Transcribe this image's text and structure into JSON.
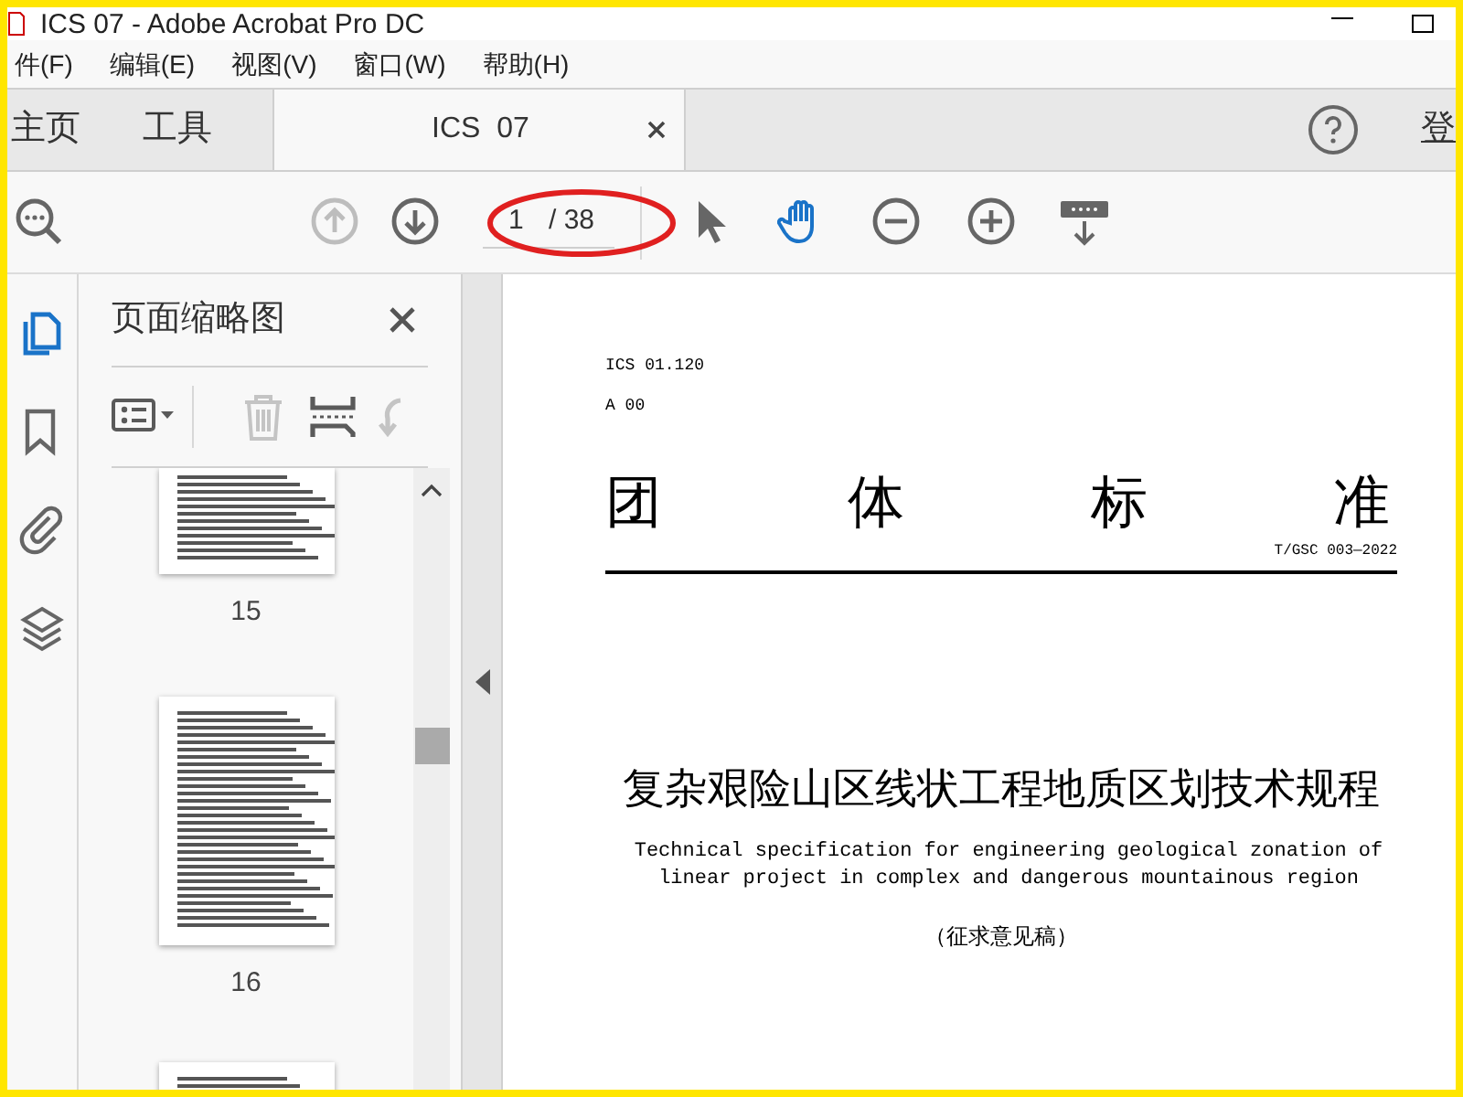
{
  "window": {
    "title": "ICS 07 - Adobe Acrobat Pro DC"
  },
  "menu": [
    "件(F)",
    "编辑(E)",
    "视图(V)",
    "窗口(W)",
    "帮助(H)"
  ],
  "tabs": [
    {
      "label": "主页",
      "kind": "nav",
      "selected": false
    },
    {
      "label": "工具",
      "kind": "nav",
      "selected": false
    },
    {
      "label": "ICS  07",
      "kind": "document",
      "selected": true
    }
  ],
  "account": {
    "label": "登"
  },
  "toolbar": {
    "tools": [
      {
        "kind": "find",
        "disabled": false,
        "selected": false
      },
      {
        "kind": "prev-page",
        "disabled": true,
        "selected": false
      },
      {
        "kind": "next-page",
        "disabled": false,
        "selected": false
      },
      {
        "kind": "page-field",
        "value": "1",
        "total": "/ 38"
      },
      {
        "kind": "select",
        "disabled": false,
        "selected": false
      },
      {
        "kind": "hand",
        "disabled": false,
        "selected": true
      },
      {
        "kind": "zoom-out",
        "disabled": false,
        "selected": false
      },
      {
        "kind": "zoom-in",
        "disabled": false,
        "selected": false
      },
      {
        "kind": "keyboard-download",
        "disabled": false,
        "selected": false
      }
    ]
  },
  "rail": [
    {
      "kind": "pages",
      "selected": true
    },
    {
      "kind": "bookmark",
      "selected": false
    },
    {
      "kind": "attachment",
      "selected": false
    },
    {
      "kind": "layers",
      "selected": false
    }
  ],
  "thumbnail_panel": {
    "title": "页面缩略图",
    "tools": [
      {
        "kind": "options",
        "disabled": false
      },
      {
        "kind": "delete",
        "disabled": true
      },
      {
        "kind": "insert",
        "disabled": false
      },
      {
        "kind": "rotate",
        "disabled": true
      }
    ],
    "thumbnails": [
      {
        "label": "15",
        "kind": "cut-top"
      },
      {
        "label": "16",
        "kind": "full"
      },
      {
        "kind": "cut-bottom"
      }
    ]
  },
  "document": {
    "ics": "ICS 01.120",
    "code": "A 00",
    "heading": [
      "团",
      "体",
      "标",
      "准"
    ],
    "number": "T/GSC 003—2022",
    "title": "复杂艰险山区线状工程地质区划技术规程",
    "english": "Technical specification for engineering geological zonation of linear project in complex and dangerous mountainous region",
    "stage": "（征求意见稿）"
  }
}
